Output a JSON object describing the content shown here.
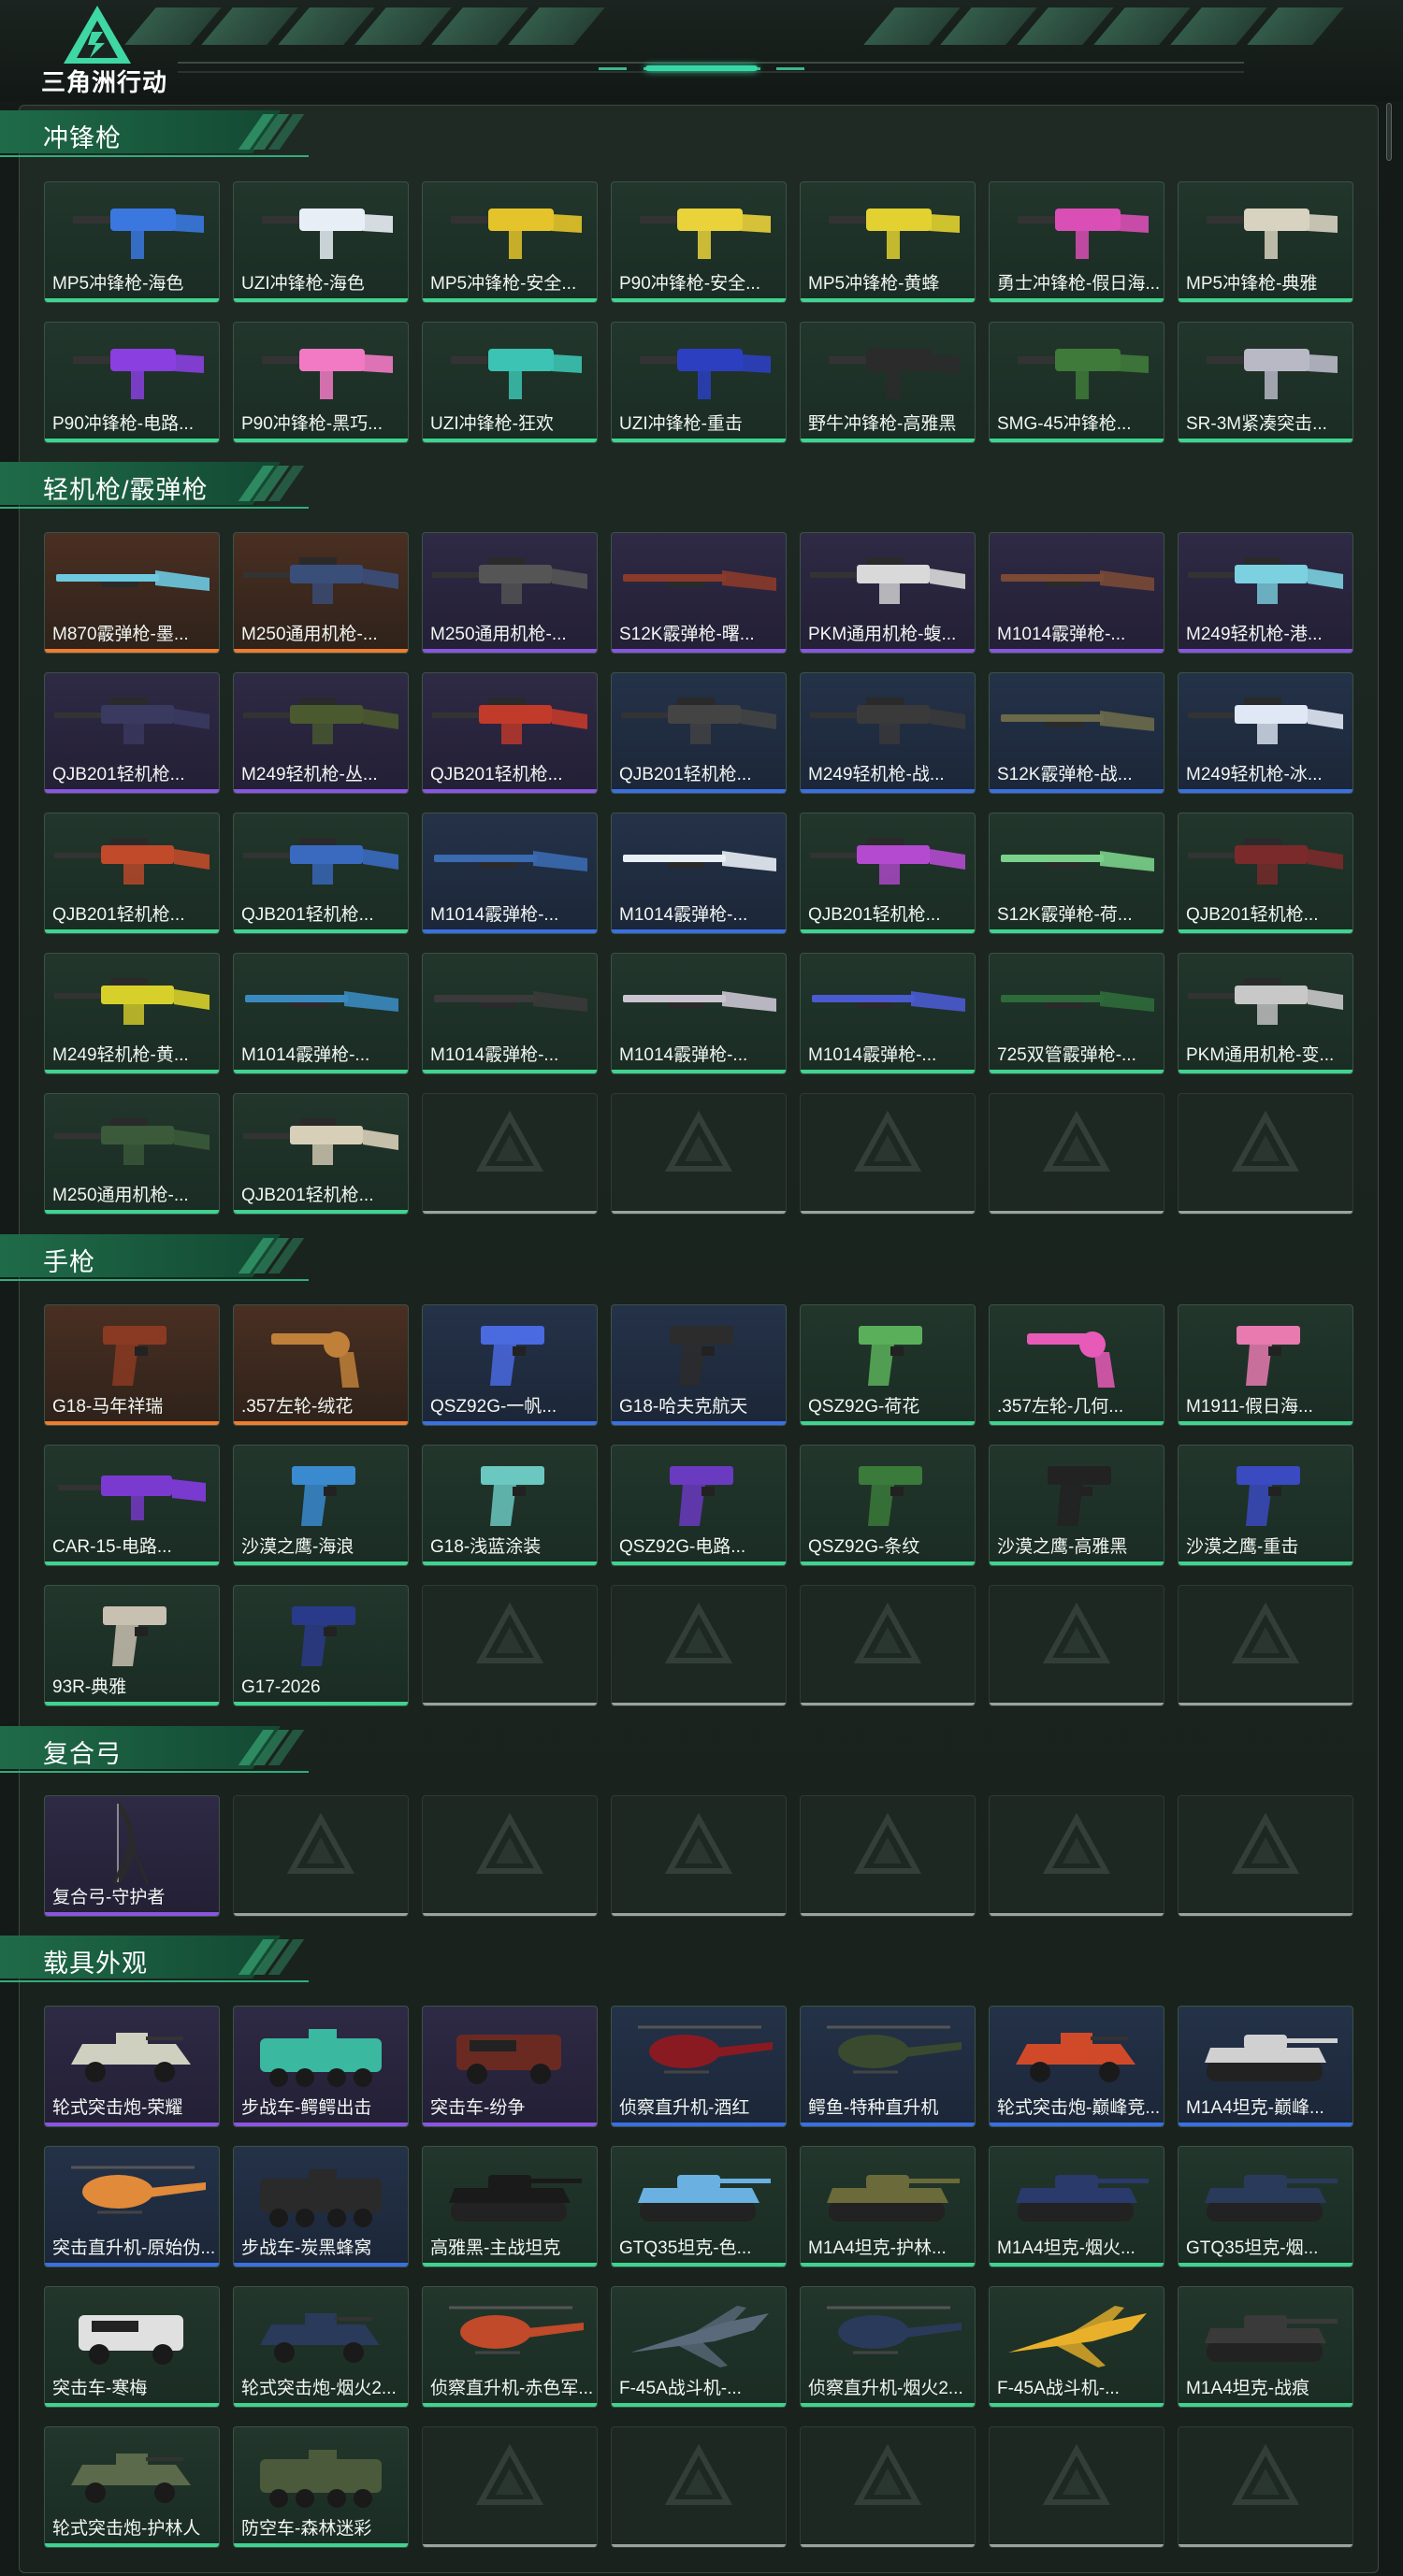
{
  "app": {
    "logo_text": "三角洲行动"
  },
  "sections": [
    {
      "title": "冲锋枪",
      "items": [
        {
          "name": "MP5冲锋枪-海色",
          "rarity": "green",
          "icon": "smg-icon",
          "color": "#3a78e0"
        },
        {
          "name": "UZI冲锋枪-海色",
          "rarity": "green",
          "icon": "smg-icon",
          "color": "#e8eef5"
        },
        {
          "name": "MP5冲锋枪-安全...",
          "rarity": "green",
          "icon": "smg-icon",
          "color": "#e4c42a"
        },
        {
          "name": "P90冲锋枪-安全...",
          "rarity": "green",
          "icon": "smg-icon",
          "color": "#e9d23a"
        },
        {
          "name": "MP5冲锋枪-黄蜂",
          "rarity": "green",
          "icon": "smg-icon",
          "color": "#e2d130"
        },
        {
          "name": "勇士冲锋枪-假日海...",
          "rarity": "green",
          "icon": "smg-icon",
          "color": "#d94fb5"
        },
        {
          "name": "MP5冲锋枪-典雅",
          "rarity": "green",
          "icon": "smg-icon",
          "color": "#d8d2c0"
        },
        {
          "name": "P90冲锋枪-电路...",
          "rarity": "green",
          "icon": "smg-icon",
          "color": "#8a3fe0"
        },
        {
          "name": "P90冲锋枪-黑巧...",
          "rarity": "green",
          "icon": "smg-icon",
          "color": "#f27ac4"
        },
        {
          "name": "UZI冲锋枪-狂欢",
          "rarity": "green",
          "icon": "smg-icon",
          "color": "#3cc3b3"
        },
        {
          "name": "UZI冲锋枪-重击",
          "rarity": "green",
          "icon": "smg-icon",
          "color": "#2c3fc0"
        },
        {
          "name": "野牛冲锋枪-高雅黑",
          "rarity": "green",
          "icon": "smg-icon",
          "color": "#2b2b2b"
        },
        {
          "name": "SMG-45冲锋枪...",
          "rarity": "green",
          "icon": "smg-icon",
          "color": "#3f7a3a"
        },
        {
          "name": "SR-3M紧凑突击...",
          "rarity": "green",
          "icon": "smg-icon",
          "color": "#b9b9c6"
        }
      ]
    },
    {
      "title": "轻机枪/霰弹枪",
      "items": [
        {
          "name": "M870霰弹枪-墨...",
          "rarity": "orange",
          "icon": "shotgun-icon",
          "color": "#6dc9e0"
        },
        {
          "name": "M250通用机枪-...",
          "rarity": "orange",
          "icon": "lmg-icon",
          "color": "#3a4e7a"
        },
        {
          "name": "M250通用机枪-...",
          "rarity": "purple",
          "icon": "lmg-icon",
          "color": "#555555"
        },
        {
          "name": "S12K霰弹枪-曙...",
          "rarity": "purple",
          "icon": "shotgun-icon",
          "color": "#8a3a2a"
        },
        {
          "name": "PKM通用机枪-蝮...",
          "rarity": "purple",
          "icon": "lmg-icon",
          "color": "#d9d9d9"
        },
        {
          "name": "M1014霰弹枪-...",
          "rarity": "purple",
          "icon": "shotgun-icon",
          "color": "#7a4a35"
        },
        {
          "name": "M249轻机枪-港...",
          "rarity": "purple",
          "icon": "lmg-icon",
          "color": "#7bd1e0"
        },
        {
          "name": "QJB201轻机枪...",
          "rarity": "purple",
          "icon": "lmg-icon",
          "color": "#3a3a60"
        },
        {
          "name": "M249轻机枪-丛...",
          "rarity": "purple",
          "icon": "lmg-icon",
          "color": "#4a5a2e"
        },
        {
          "name": "QJB201轻机枪...",
          "rarity": "purple",
          "icon": "lmg-icon",
          "color": "#c23a2a"
        },
        {
          "name": "QJB201轻机枪...",
          "rarity": "blue",
          "icon": "lmg-icon",
          "color": "#444444"
        },
        {
          "name": "M249轻机枪-战...",
          "rarity": "blue",
          "icon": "lmg-icon",
          "color": "#3a3a3a"
        },
        {
          "name": "S12K霰弹枪-战...",
          "rarity": "blue",
          "icon": "shotgun-icon",
          "color": "#6a6a4a"
        },
        {
          "name": "M249轻机枪-冰...",
          "rarity": "blue",
          "icon": "lmg-icon",
          "color": "#e0e8f5"
        },
        {
          "name": "QJB201轻机枪...",
          "rarity": "green",
          "icon": "lmg-icon",
          "color": "#c04a2a"
        },
        {
          "name": "QJB201轻机枪...",
          "rarity": "green",
          "icon": "lmg-icon",
          "color": "#3a6ac0"
        },
        {
          "name": "M1014霰弹枪-...",
          "rarity": "blue",
          "icon": "shotgun-icon",
          "color": "#3a6ab0"
        },
        {
          "name": "M1014霰弹枪-...",
          "rarity": "blue",
          "icon": "shotgun-icon",
          "color": "#e8eef5"
        },
        {
          "name": "QJB201轻机枪...",
          "rarity": "green",
          "icon": "lmg-icon",
          "color": "#b44ad0"
        },
        {
          "name": "S12K霰弹枪-荷...",
          "rarity": "green",
          "icon": "shotgun-icon",
          "color": "#7ad08a"
        },
        {
          "name": "QJB201轻机枪...",
          "rarity": "green",
          "icon": "lmg-icon",
          "color": "#7a2a2a"
        },
        {
          "name": "M249轻机枪-黄...",
          "rarity": "green",
          "icon": "lmg-icon",
          "color": "#d8d02a"
        },
        {
          "name": "M1014霰弹枪-...",
          "rarity": "green",
          "icon": "shotgun-icon",
          "color": "#3a8ac0"
        },
        {
          "name": "M1014霰弹枪-...",
          "rarity": "green",
          "icon": "shotgun-icon",
          "color": "#3a3a3a"
        },
        {
          "name": "M1014霰弹枪-...",
          "rarity": "green",
          "icon": "shotgun-icon",
          "color": "#c9c4d0"
        },
        {
          "name": "M1014霰弹枪-...",
          "rarity": "green",
          "icon": "shotgun-icon",
          "color": "#4a5ad0"
        },
        {
          "name": "725双管霰弹枪-...",
          "rarity": "green",
          "icon": "shotgun-icon",
          "color": "#2e6a3a"
        },
        {
          "name": "PKM通用机枪-变...",
          "rarity": "green",
          "icon": "lmg-icon",
          "color": "#c8c8c8"
        },
        {
          "name": "M250通用机枪-...",
          "rarity": "green",
          "icon": "lmg-icon",
          "color": "#3a5a3a"
        },
        {
          "name": "QJB201轻机枪...",
          "rarity": "green",
          "icon": "lmg-icon",
          "color": "#d8cfb8"
        },
        {
          "name": "",
          "rarity": "empty"
        },
        {
          "name": "",
          "rarity": "empty"
        },
        {
          "name": "",
          "rarity": "empty"
        },
        {
          "name": "",
          "rarity": "empty"
        },
        {
          "name": "",
          "rarity": "empty"
        }
      ]
    },
    {
      "title": "手枪",
      "items": [
        {
          "name": "G18-马年祥瑞",
          "rarity": "orange",
          "icon": "pistol-icon",
          "color": "#8a3a22"
        },
        {
          "name": ".357左轮-绒花",
          "rarity": "orange",
          "icon": "revolver-icon",
          "color": "#c0803a"
        },
        {
          "name": "QSZ92G-一帆...",
          "rarity": "blue",
          "icon": "pistol-icon",
          "color": "#4a6ae0"
        },
        {
          "name": "G18-哈夫克航天",
          "rarity": "blue",
          "icon": "pistol-icon",
          "color": "#2c2c2c"
        },
        {
          "name": "QSZ92G-荷花",
          "rarity": "green",
          "icon": "pistol-icon",
          "color": "#5ab05a"
        },
        {
          "name": ".357左轮-几何...",
          "rarity": "green",
          "icon": "revolver-icon",
          "color": "#e85ab8"
        },
        {
          "name": "M1911-假日海...",
          "rarity": "green",
          "icon": "pistol-icon",
          "color": "#e87ab0"
        },
        {
          "name": "CAR-15-电路...",
          "rarity": "green",
          "icon": "rifle-icon",
          "color": "#7a3ad0"
        },
        {
          "name": "沙漠之鹰-海浪",
          "rarity": "green",
          "icon": "pistol-icon",
          "color": "#3a8ad0"
        },
        {
          "name": "G18-浅蓝涂装",
          "rarity": "green",
          "icon": "pistol-icon",
          "color": "#6ac8c0"
        },
        {
          "name": "QSZ92G-电路...",
          "rarity": "green",
          "icon": "pistol-icon",
          "color": "#6a3ac0"
        },
        {
          "name": "QSZ92G-条纹",
          "rarity": "green",
          "icon": "pistol-icon",
          "color": "#3a7a3a"
        },
        {
          "name": "沙漠之鹰-高雅黑",
          "rarity": "green",
          "icon": "pistol-icon",
          "color": "#222222"
        },
        {
          "name": "沙漠之鹰-重击",
          "rarity": "green",
          "icon": "pistol-icon",
          "color": "#3a4ac0"
        },
        {
          "name": "93R-典雅",
          "rarity": "green",
          "icon": "pistol-icon",
          "color": "#c8c0b0"
        },
        {
          "name": "G17-2026",
          "rarity": "green",
          "icon": "pistol-icon",
          "color": "#2a3a8a"
        },
        {
          "name": "",
          "rarity": "empty"
        },
        {
          "name": "",
          "rarity": "empty"
        },
        {
          "name": "",
          "rarity": "empty"
        },
        {
          "name": "",
          "rarity": "empty"
        },
        {
          "name": "",
          "rarity": "empty"
        }
      ]
    },
    {
      "title": "复合弓",
      "items": [
        {
          "name": "复合弓-守护者",
          "rarity": "purple",
          "icon": "bow-icon",
          "color": "#2a2a2a"
        },
        {
          "name": "",
          "rarity": "empty"
        },
        {
          "name": "",
          "rarity": "empty"
        },
        {
          "name": "",
          "rarity": "empty"
        },
        {
          "name": "",
          "rarity": "empty"
        },
        {
          "name": "",
          "rarity": "empty"
        },
        {
          "name": "",
          "rarity": "empty"
        }
      ]
    },
    {
      "title": "载具外观",
      "items": [
        {
          "name": "轮式突击炮-荣耀",
          "rarity": "purple",
          "icon": "armored-car-icon",
          "color": "#d0d0c0"
        },
        {
          "name": "步战车-鳄鳄出击",
          "rarity": "purple",
          "icon": "apc-icon",
          "color": "#3ab8a0"
        },
        {
          "name": "突击车-纷争",
          "rarity": "purple",
          "icon": "truck-icon",
          "color": "#6a2a22"
        },
        {
          "name": "侦察直升机-酒红",
          "rarity": "blue",
          "icon": "helicopter-icon",
          "color": "#8a1a22"
        },
        {
          "name": "鳄鱼-特种直升机",
          "rarity": "blue",
          "icon": "helicopter-icon",
          "color": "#3a4a2e"
        },
        {
          "name": "轮式突击炮-巅峰竞...",
          "rarity": "blue",
          "icon": "armored-car-icon",
          "color": "#d04a2a"
        },
        {
          "name": "M1A4坦克-巅峰...",
          "rarity": "blue",
          "icon": "tank-icon",
          "color": "#d0d0d0"
        },
        {
          "name": "突击直升机-原始伪...",
          "rarity": "blue",
          "icon": "helicopter-icon",
          "color": "#e08a3a"
        },
        {
          "name": "步战车-炭黑蜂窝",
          "rarity": "blue",
          "icon": "apc-icon",
          "color": "#2a2a2a"
        },
        {
          "name": "高雅黑-主战坦克",
          "rarity": "green",
          "icon": "tank-icon",
          "color": "#1a1a1a"
        },
        {
          "name": "GTQ35坦克-色...",
          "rarity": "green",
          "icon": "tank-icon",
          "color": "#6ab0e0"
        },
        {
          "name": "M1A4坦克-护林...",
          "rarity": "green",
          "icon": "tank-icon",
          "color": "#6a6a3a"
        },
        {
          "name": "M1A4坦克-烟火...",
          "rarity": "green",
          "icon": "tank-icon",
          "color": "#2a3a6a"
        },
        {
          "name": "GTQ35坦克-烟...",
          "rarity": "green",
          "icon": "tank-icon",
          "color": "#2a3a5a"
        },
        {
          "name": "突击车-寒梅",
          "rarity": "green",
          "icon": "truck-icon",
          "color": "#e0e0e0"
        },
        {
          "name": "轮式突击炮-烟火2...",
          "rarity": "green",
          "icon": "armored-car-icon",
          "color": "#2a3a5a"
        },
        {
          "name": "侦察直升机-赤色军...",
          "rarity": "green",
          "icon": "helicopter-icon",
          "color": "#c04a2a"
        },
        {
          "name": "F-45A战斗机-...",
          "rarity": "green",
          "icon": "jet-icon",
          "color": "#5a6a7a"
        },
        {
          "name": "侦察直升机-烟火2...",
          "rarity": "green",
          "icon": "helicopter-icon",
          "color": "#2a3a5a"
        },
        {
          "name": "F-45A战斗机-...",
          "rarity": "green",
          "icon": "jet-icon",
          "color": "#e8b02a"
        },
        {
          "name": "M1A4坦克-战痕",
          "rarity": "green",
          "icon": "tank-icon",
          "color": "#3a3a3a"
        },
        {
          "name": "轮式突击炮-护林人",
          "rarity": "green",
          "icon": "armored-car-icon",
          "color": "#5a6a4a"
        },
        {
          "name": "防空车-森林迷彩",
          "rarity": "green",
          "icon": "apc-icon",
          "color": "#4a5a3a"
        },
        {
          "name": "",
          "rarity": "empty"
        },
        {
          "name": "",
          "rarity": "empty"
        },
        {
          "name": "",
          "rarity": "empty"
        },
        {
          "name": "",
          "rarity": "empty"
        },
        {
          "name": "",
          "rarity": "empty"
        }
      ]
    }
  ]
}
